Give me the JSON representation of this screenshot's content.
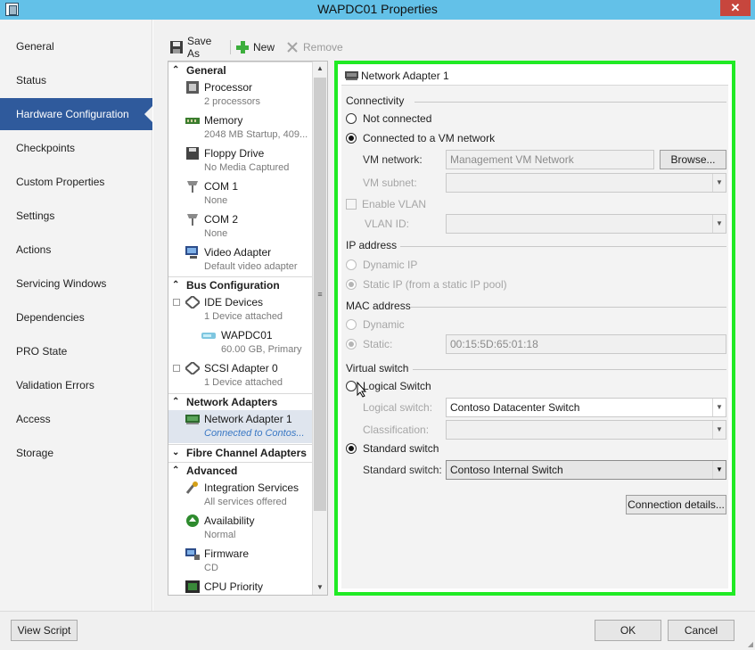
{
  "window": {
    "title": "WAPDC01 Properties",
    "close_label": "✕"
  },
  "sidebar": {
    "items": [
      {
        "label": "General"
      },
      {
        "label": "Status"
      },
      {
        "label": "Hardware Configuration"
      },
      {
        "label": "Checkpoints"
      },
      {
        "label": "Custom Properties"
      },
      {
        "label": "Settings"
      },
      {
        "label": "Actions"
      },
      {
        "label": "Servicing Windows"
      },
      {
        "label": "Dependencies"
      },
      {
        "label": "PRO State"
      },
      {
        "label": "Validation Errors"
      },
      {
        "label": "Access"
      },
      {
        "label": "Storage"
      }
    ]
  },
  "toolbar": {
    "save_as": "Save As",
    "new": "New",
    "remove": "Remove"
  },
  "tree": {
    "general": "General",
    "processor": {
      "label": "Processor",
      "sub": "2 processors"
    },
    "memory": {
      "label": "Memory",
      "sub": "2048 MB Startup, 409..."
    },
    "floppy": {
      "label": "Floppy Drive",
      "sub": "No Media Captured"
    },
    "com1": {
      "label": "COM 1",
      "sub": "None"
    },
    "com2": {
      "label": "COM 2",
      "sub": "None"
    },
    "video": {
      "label": "Video Adapter",
      "sub": "Default video adapter"
    },
    "bus": "Bus Configuration",
    "ide": {
      "label": "IDE Devices",
      "sub": "1 Device attached"
    },
    "wapdc01": {
      "label": "WAPDC01",
      "sub": "60.00 GB, Primary"
    },
    "scsi": {
      "label": "SCSI Adapter 0",
      "sub": "1 Device attached"
    },
    "network": "Network Adapters",
    "nic1": {
      "label": "Network Adapter 1",
      "sub": "Connected to Contos..."
    },
    "fibre": "Fibre Channel Adapters",
    "advanced": "Advanced",
    "integration": {
      "label": "Integration Services",
      "sub": "All services offered"
    },
    "availability": {
      "label": "Availability",
      "sub": "Normal"
    },
    "firmware": {
      "label": "Firmware",
      "sub": "CD"
    },
    "cpu_priority": {
      "label": "CPU Priority"
    }
  },
  "detail": {
    "header": "Network Adapter 1",
    "connectivity": {
      "title": "Connectivity",
      "not_connected": "Not connected",
      "connected_vm": "Connected to a VM network",
      "vm_network_label": "VM network:",
      "vm_network_value": "Management VM Network",
      "browse": "Browse...",
      "vm_subnet_label": "VM subnet:",
      "enable_vlan": "Enable VLAN",
      "vlan_id_label": "VLAN ID:"
    },
    "ip": {
      "title": "IP address",
      "dynamic": "Dynamic IP",
      "static": "Static IP (from a static IP pool)"
    },
    "mac": {
      "title": "MAC address",
      "dynamic": "Dynamic",
      "static": "Static:",
      "value": "00:15:5D:65:01:18"
    },
    "vswitch": {
      "title": "Virtual switch",
      "logical": "Logical Switch",
      "logical_label": "Logical switch:",
      "logical_value": "Contoso Datacenter Switch",
      "classification_label": "Classification:",
      "standard": "Standard switch",
      "standard_label": "Standard switch:",
      "standard_value": "Contoso Internal Switch",
      "connection_details": "Connection details..."
    }
  },
  "footer": {
    "view_script": "View Script",
    "ok": "OK",
    "cancel": "Cancel"
  },
  "colors": {
    "accent": "#2f5a9c",
    "highlight_frame": "#20ea24",
    "titlebar": "#63c1e8",
    "close": "#c7463d"
  }
}
